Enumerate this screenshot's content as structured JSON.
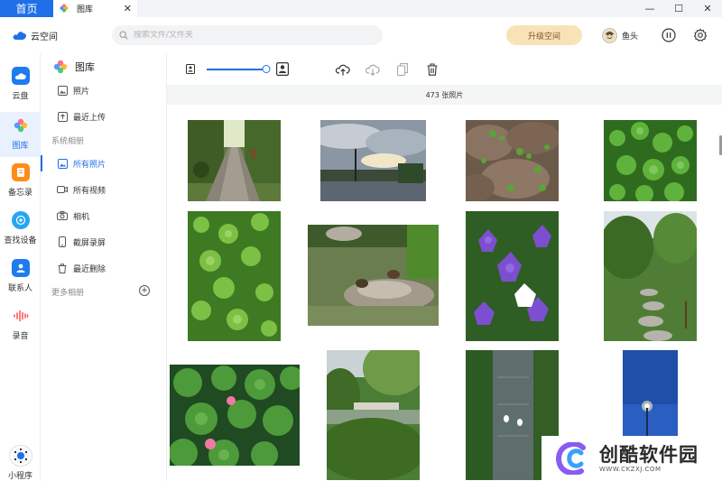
{
  "window": {
    "tab_home": "首页",
    "tab_gallery": "图库",
    "tab_close": "✕",
    "minimize": "—",
    "maximize": "☐",
    "close": "✕"
  },
  "header": {
    "brand": "云空间",
    "search_placeholder": "搜索文件/文件夹",
    "upgrade": "升级空间",
    "username": "鱼头"
  },
  "rail": {
    "items": [
      {
        "label": "云盘",
        "icon": "cloud-drive-icon",
        "color": "#1e7bf0"
      },
      {
        "label": "图库",
        "icon": "gallery-icon",
        "color": "#ff6b8a"
      },
      {
        "label": "备忘录",
        "icon": "notes-icon",
        "color": "#ff8c1a"
      },
      {
        "label": "查找设备",
        "icon": "find-device-icon",
        "color": "#25a6f5"
      },
      {
        "label": "联系人",
        "icon": "contacts-icon",
        "color": "#1e7bf0"
      },
      {
        "label": "录音",
        "icon": "recorder-icon",
        "color": "#ff4d4f"
      }
    ],
    "mini_program": "小程序"
  },
  "sidebar": {
    "title": "图库",
    "items": [
      {
        "label": "照片"
      },
      {
        "label": "最近上传"
      },
      {
        "label": "所有照片"
      },
      {
        "label": "所有视频"
      },
      {
        "label": "相机"
      },
      {
        "label": "截屏录屏"
      },
      {
        "label": "最近删除"
      }
    ],
    "group_system": "系统相册",
    "group_more": "更多相册",
    "add": "+"
  },
  "toolbar": {
    "zoom_level": 1.0
  },
  "gallery": {
    "count_text": "473 张照片",
    "photos": [
      {
        "name": "tree-lined-path"
      },
      {
        "name": "cloudy-sky-street"
      },
      {
        "name": "rocks-with-ivy"
      },
      {
        "name": "green-clover-leaves"
      },
      {
        "name": "green-plants"
      },
      {
        "name": "pond-with-ducks"
      },
      {
        "name": "purple-bellflowers"
      },
      {
        "name": "park-stone-path"
      },
      {
        "name": "lotus-leaves-pink-flowers"
      },
      {
        "name": "willow-pond-bridge"
      },
      {
        "name": "stream-with-reflections"
      },
      {
        "name": "night-street-lamp"
      }
    ]
  },
  "watermark": {
    "text": "创酷软件园",
    "url": "WWW.CKZXJ.COM"
  },
  "colors": {
    "accent": "#1e6fe8",
    "upgrade_bg": "#f8e3b8"
  }
}
